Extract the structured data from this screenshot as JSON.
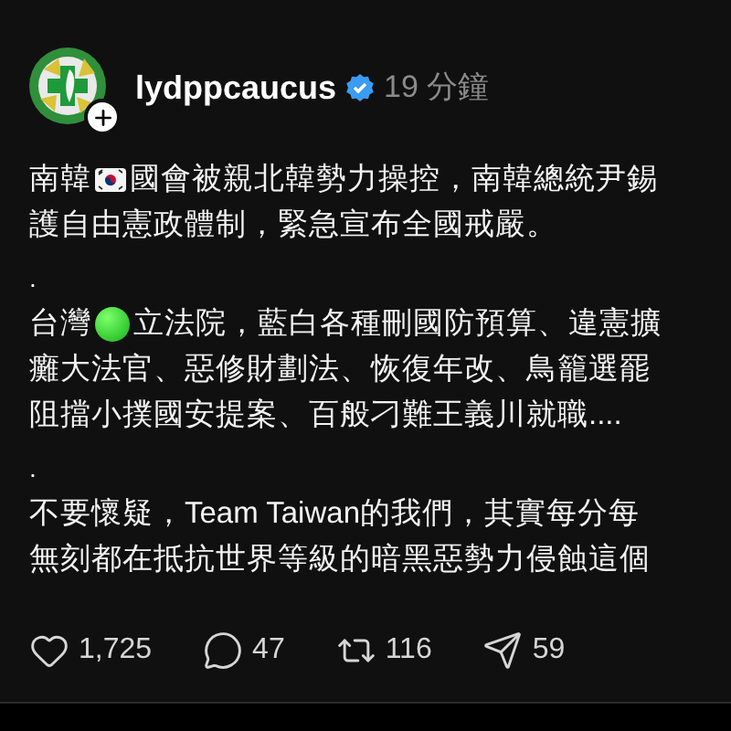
{
  "post": {
    "username": "lydppcaucus",
    "verified": true,
    "time": "19 分鐘",
    "lines": [
      {
        "kind": "flag",
        "before": "南韓",
        "after": "國會被親北韓勢力操控，南韓總統尹錫"
      },
      {
        "kind": "plain",
        "text": "護自由憲政體制，緊急宣布全國戒嚴。"
      },
      {
        "kind": "gap",
        "text": "."
      },
      {
        "kind": "circle",
        "before": "台灣",
        "after": "立法院，藍白各種刪國防預算、違憲擴"
      },
      {
        "kind": "plain",
        "text": "癱大法官、惡修財劃法、恢復年改、鳥籠選罷"
      },
      {
        "kind": "plain",
        "text": "阻擋小撲國安提案、百般刁難王義川就職...."
      },
      {
        "kind": "gap",
        "text": "."
      },
      {
        "kind": "plain",
        "text": "不要懷疑，Team Taiwan的我們，其實每分每"
      },
      {
        "kind": "plain",
        "text": "無刻都在抵抗世界等級的暗黑惡勢力侵蝕這個"
      }
    ],
    "actions": [
      {
        "kind": "like",
        "count": "1,725"
      },
      {
        "kind": "comment",
        "count": "47"
      },
      {
        "kind": "repost",
        "count": "116"
      },
      {
        "kind": "share",
        "count": "59"
      }
    ]
  }
}
